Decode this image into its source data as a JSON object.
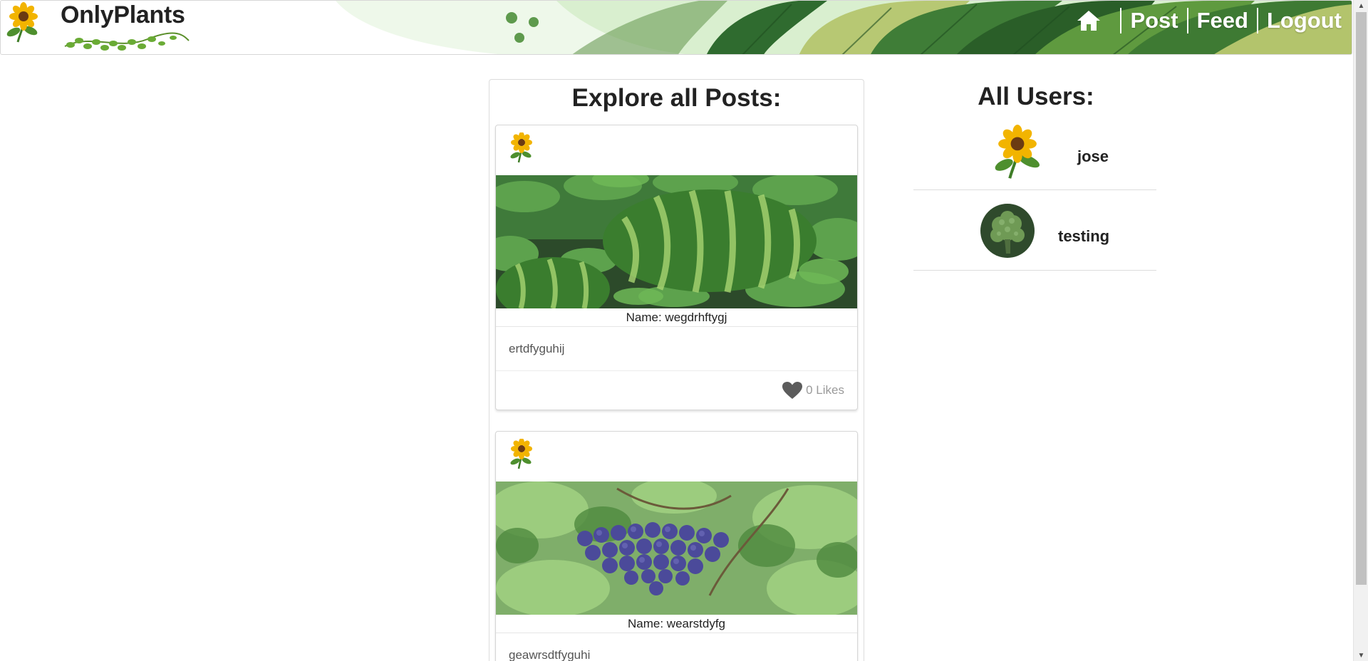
{
  "app": {
    "brand_title": "OnlyPlants"
  },
  "nav": {
    "home_icon": "home-icon",
    "links": [
      "Post",
      "Feed",
      "Logout"
    ]
  },
  "posts_panel": {
    "heading": "Explore all Posts:",
    "posts": [
      {
        "avatar_icon": "sunflower-icon",
        "image": "watermelon-photo",
        "name_text": "Name: wegdrhftygj",
        "description": "ertdfyguhij",
        "likes_text": "0 Likes",
        "likes_count": 0
      },
      {
        "avatar_icon": "sunflower-icon",
        "image": "grapes-photo",
        "name_text": "Name: wearstdyfg",
        "description": "geawrsdtfyguhi"
      }
    ]
  },
  "users_panel": {
    "heading": "All Users:",
    "users": [
      {
        "name": "jose",
        "avatar": "sunflower-avatar"
      },
      {
        "name": "testing",
        "avatar": "broccoli-avatar"
      }
    ]
  },
  "colors": {
    "banner_dark_green": "#2f6b2f",
    "banner_mid_green": "#5f9a3f",
    "banner_light_green": "#e8f5e1",
    "banner_olive": "#b7c873",
    "heart_gray": "#5c5c5c"
  }
}
